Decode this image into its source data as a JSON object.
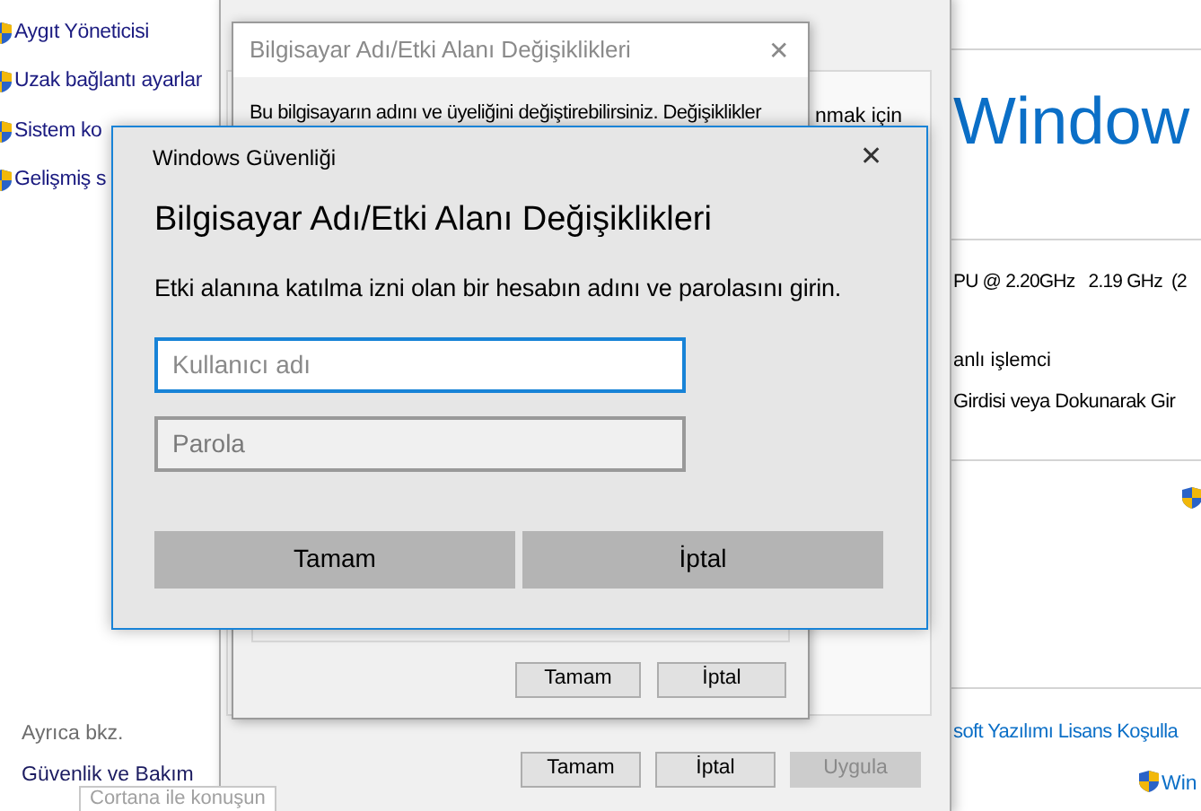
{
  "control_panel": {
    "sidebar_links": [
      "Aygıt Yöneticisi",
      "Uzak bağlantı ayarlar",
      "Sistem ko",
      "Gelişmiş s"
    ],
    "see_also_heading": "Ayrıca bkz.",
    "see_also_links": [
      "Güvenlik ve Bakım"
    ],
    "tooltip": "Cortana ile konuşun",
    "edition_title": "Window",
    "processor": "PU @ 2.20GHz   2.19 GHz  (2",
    "system_type": "anlı işlemci",
    "pen_touch": "Girdisi veya Dokunarak Gir",
    "license_link": "soft Yazılımı Lisans Koşulla",
    "activation_link": "Win"
  },
  "system_properties": {
    "panel_text": "nmak için",
    "buttons": [
      {
        "label": "Tamam",
        "disabled": false
      },
      {
        "label": "İptal",
        "disabled": false
      },
      {
        "label": "Uygula",
        "disabled": true
      }
    ]
  },
  "computer_name_dialog": {
    "title": "Bilgisayar Adı/Etki Alanı Değişiklikleri",
    "close": "✕",
    "text": "Bu bilgisayarın adını ve üyeliğini değiştirebilirsiniz. Değişiklikler",
    "buttons": [
      "Tamam",
      "İptal"
    ]
  },
  "security_dialog": {
    "title": "Windows Güvenliği",
    "close": "✕",
    "heading": "Bilgisayar Adı/Etki Alanı Değişiklikleri",
    "instruction": "Etki alanına katılma izni olan bir hesabın adını ve parolasını girin.",
    "fields": [
      {
        "placeholder": "Kullanıcı adı",
        "focused": true
      },
      {
        "placeholder": "Parola",
        "focused": false
      }
    ],
    "buttons": [
      "Tamam",
      "İptal"
    ]
  }
}
